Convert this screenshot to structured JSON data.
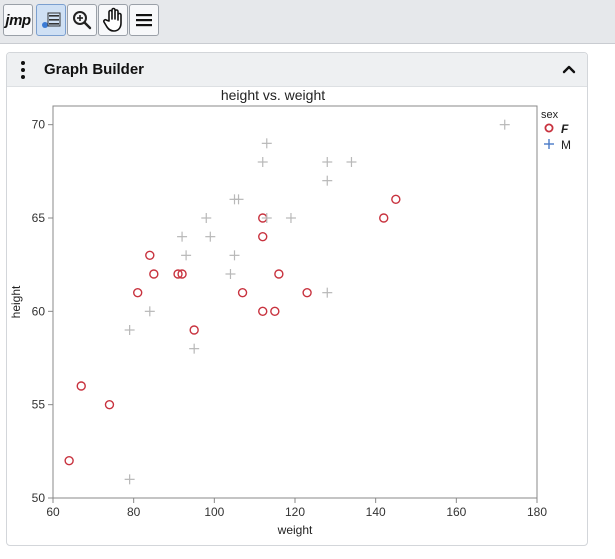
{
  "toolbar": {
    "logo_text": "jmp",
    "buttons": [
      {
        "name": "logo-button",
        "icon": "jmp-logo"
      },
      {
        "name": "select-tool-button",
        "icon": "arrow-list-icon",
        "selected": true
      },
      {
        "name": "zoom-tool-button",
        "icon": "magnifier-plus-icon"
      },
      {
        "name": "grabber-tool-button",
        "icon": "hand-icon"
      },
      {
        "name": "main-menu-button",
        "icon": "hamburger-menu-icon"
      }
    ]
  },
  "panel": {
    "title": "Graph Builder",
    "collapse_icon": "chevron-up-icon"
  },
  "chart_data": {
    "type": "scatter",
    "title": "height vs. weight",
    "xlabel": "weight",
    "ylabel": "height",
    "xlim": [
      60,
      180
    ],
    "ylim": [
      50,
      71
    ],
    "xticks": [
      "60",
      "80",
      "100",
      "120",
      "140",
      "160",
      "180"
    ],
    "yticks": [
      "50",
      "55",
      "60",
      "65",
      "70"
    ],
    "grid": false,
    "legend": {
      "title": "sex",
      "position": "right",
      "entries": [
        {
          "label": "F",
          "marker": "circle",
          "color": "#c8323e"
        },
        {
          "label": "M",
          "marker": "plus",
          "color": "#4a7ac7"
        }
      ]
    },
    "series": [
      {
        "name": "F",
        "marker": "circle",
        "color": "#c8323e",
        "points": [
          [
            64,
            52
          ],
          [
            67,
            56
          ],
          [
            74,
            55
          ],
          [
            81,
            61
          ],
          [
            84,
            63
          ],
          [
            85,
            62
          ],
          [
            91,
            62
          ],
          [
            92,
            62
          ],
          [
            95,
            59
          ],
          [
            107,
            61
          ],
          [
            112,
            65
          ],
          [
            112,
            64
          ],
          [
            112,
            60
          ],
          [
            115,
            60
          ],
          [
            116,
            62
          ],
          [
            123,
            61
          ],
          [
            142,
            65
          ],
          [
            145,
            66
          ]
        ]
      },
      {
        "name": "M",
        "marker": "plus",
        "color": "#b8b8b8",
        "points": [
          [
            79,
            59
          ],
          [
            79,
            51
          ],
          [
            84,
            60
          ],
          [
            92,
            64
          ],
          [
            93,
            63
          ],
          [
            95,
            58
          ],
          [
            98,
            65
          ],
          [
            99,
            64
          ],
          [
            104,
            62
          ],
          [
            105,
            63
          ],
          [
            105,
            66
          ],
          [
            106,
            66
          ],
          [
            112,
            68
          ],
          [
            113,
            69
          ],
          [
            113,
            65
          ],
          [
            119,
            65
          ],
          [
            128,
            68
          ],
          [
            128,
            67
          ],
          [
            128,
            61
          ],
          [
            134,
            68
          ],
          [
            172,
            70
          ]
        ]
      }
    ]
  }
}
